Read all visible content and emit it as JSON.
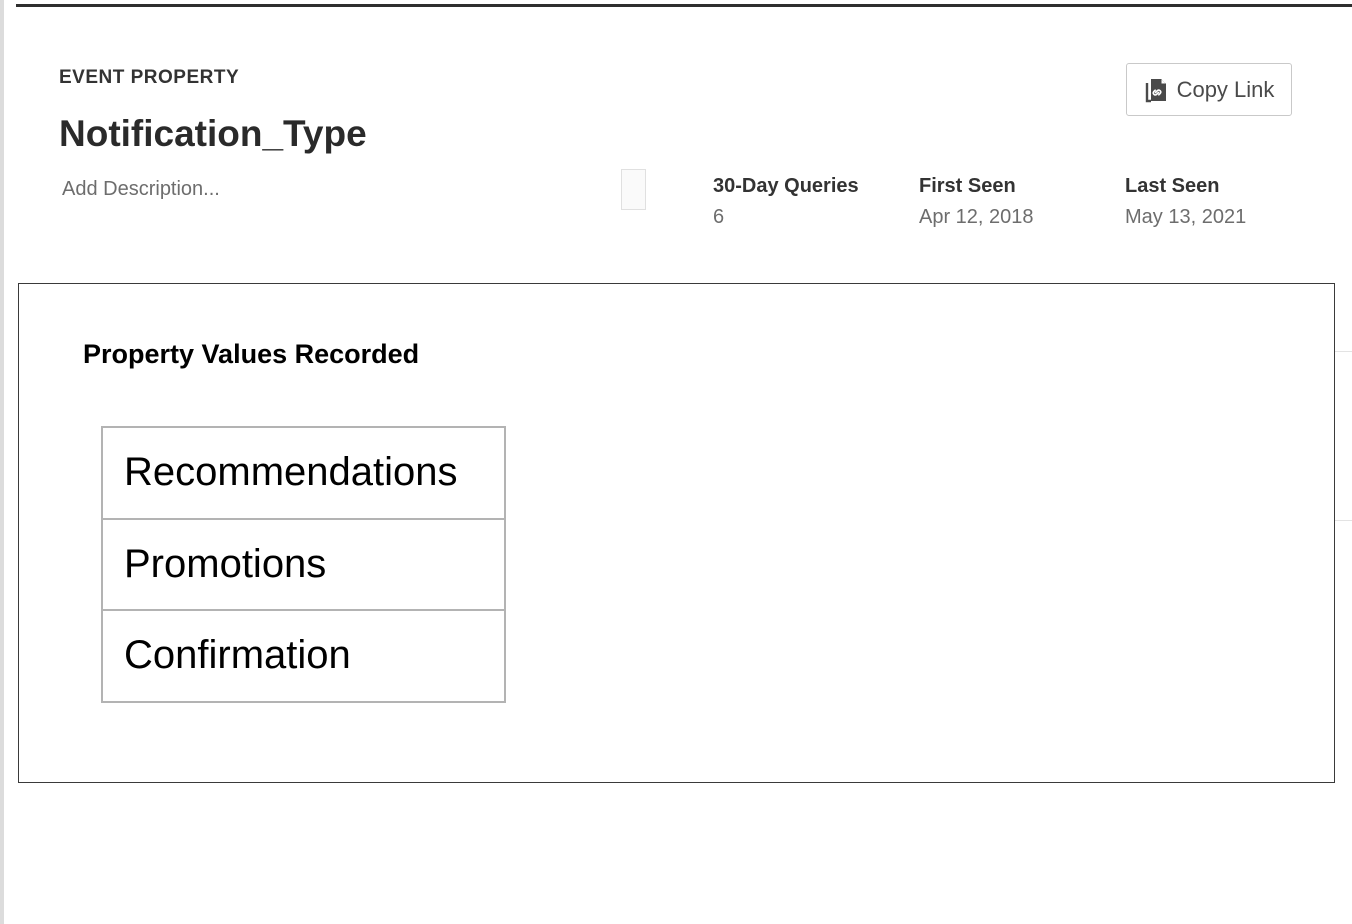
{
  "header": {
    "eyebrow": "EVENT PROPERTY",
    "title": "Notification_Type",
    "description_placeholder": "Add Description..."
  },
  "actions": {
    "copy_link_label": "Copy Link",
    "copy_link_icon": "copy-link-icon"
  },
  "stats": [
    {
      "label": "30-Day Queries",
      "value": "6"
    },
    {
      "label": "First Seen",
      "value": "Apr 12, 2018"
    },
    {
      "label": "Last Seen",
      "value": "May 13, 2021"
    }
  ],
  "values_panel": {
    "title": "Property Values Recorded",
    "values": [
      "Recommendations",
      "Promotions",
      "Confirmation"
    ]
  }
}
